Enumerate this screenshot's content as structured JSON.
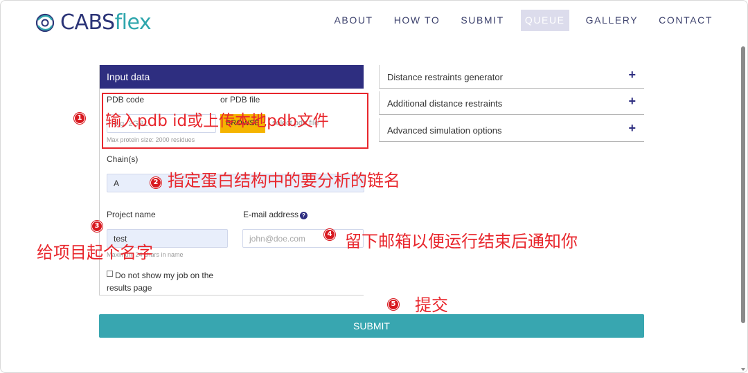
{
  "header": {
    "logo_main": "CABS",
    "logo_accent": "flex",
    "nav": [
      "ABOUT",
      "HOW TO",
      "SUBMIT",
      "QUEUE",
      "GALLERY",
      "CONTACT"
    ],
    "active_nav": "QUEUE"
  },
  "panel": {
    "title": "Input data",
    "pdb_code_label": "PDB code",
    "pdb_file_label": "or PDB file",
    "pdb_placeholder": "e.g. 2GB1",
    "browse_label": "BROWSE",
    "file_placeholder": "select pdb file",
    "protein_size_hint": "Max protein size: 2000 residues",
    "chain_label": "Chain(s)",
    "chain_value": "A",
    "project_label": "Project name",
    "project_value": "test",
    "project_hint": "Maximum 24 chars in name",
    "email_label": "E-mail address",
    "email_placeholder": "john@doe.com",
    "hide_job_label": "Do not show my job on the results page"
  },
  "accordion": [
    {
      "label": "Distance restraints generator",
      "icon": "+"
    },
    {
      "label": "Additional distance restraints",
      "icon": "+"
    },
    {
      "label": "Advanced simulation options",
      "icon": "+"
    }
  ],
  "submit_label": "SUBMIT",
  "annotations": {
    "n1": "1",
    "t1": "输入pdb id或上传本地pdb文件",
    "n2": "2",
    "t2": "指定蛋白结构中的要分析的链名",
    "n3": "3",
    "t3": "给项目起个名字",
    "n4": "4",
    "t4": "留下邮箱以便运行结束后通知你",
    "n5": "5",
    "t5": "提交"
  },
  "colors": {
    "brand_navy": "#2e2e80",
    "brand_teal": "#38a6b0",
    "browse_yellow": "#f5b400",
    "annotation_red": "#e8262c"
  }
}
